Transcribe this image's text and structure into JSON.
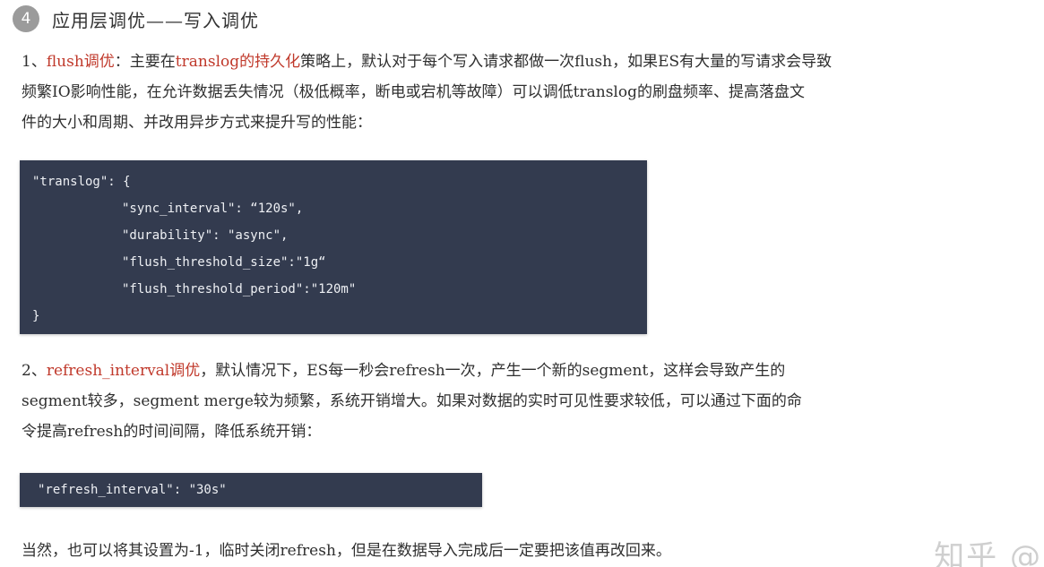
{
  "header": {
    "number": "4",
    "title": "应用层调优——写入调优"
  },
  "para1": {
    "prefix": "1、",
    "term": "flush调优",
    "text1": "：主要在",
    "highlight": "translog的持久化",
    "text2": "策略上，默认对于每个写入请求都做一次flush，如果ES有大量的写请求会导致",
    "line2": "频繁IO影响性能，在允许数据丢失情况（极低概率，断电或宕机等故障）可以调低translog的刷盘频率、提高落盘文",
    "line3": "件的大小和周期、并改用异步方式来提升写的性能："
  },
  "code1": {
    "lines": [
      "\"translog\": {",
      "\"sync_interval\": “120s\",",
      "\"durability\": \"async\",",
      "\"flush_threshold_size\":\"1g“",
      "\"flush_threshold_period\":\"120m\"",
      "}"
    ]
  },
  "para2": {
    "prefix": "2、",
    "term": "refresh_interval调优",
    "text1": "，默认情况下，ES每一秒会refresh一次，产生一个新的segment，这样会导致产生的",
    "line2": "segment较多，segment merge较为频繁，系统开销增大。如果对数据的实时可见性要求较低，可以通过下面的命",
    "line3": "令提高refresh的时间间隔，降低系统开销："
  },
  "code2": {
    "line": "\"refresh_interval\": \"30s\""
  },
  "para3": {
    "text": "当然，也可以将其设置为-1，临时关闭refresh，但是在数据导入完成后一定要把该值再改回来。"
  },
  "watermark": {
    "text": "知乎 @"
  },
  "colors": {
    "accent_red": "#c0392b",
    "code_bg": "#333b4f",
    "badge_gray": "#9b9b9b"
  }
}
